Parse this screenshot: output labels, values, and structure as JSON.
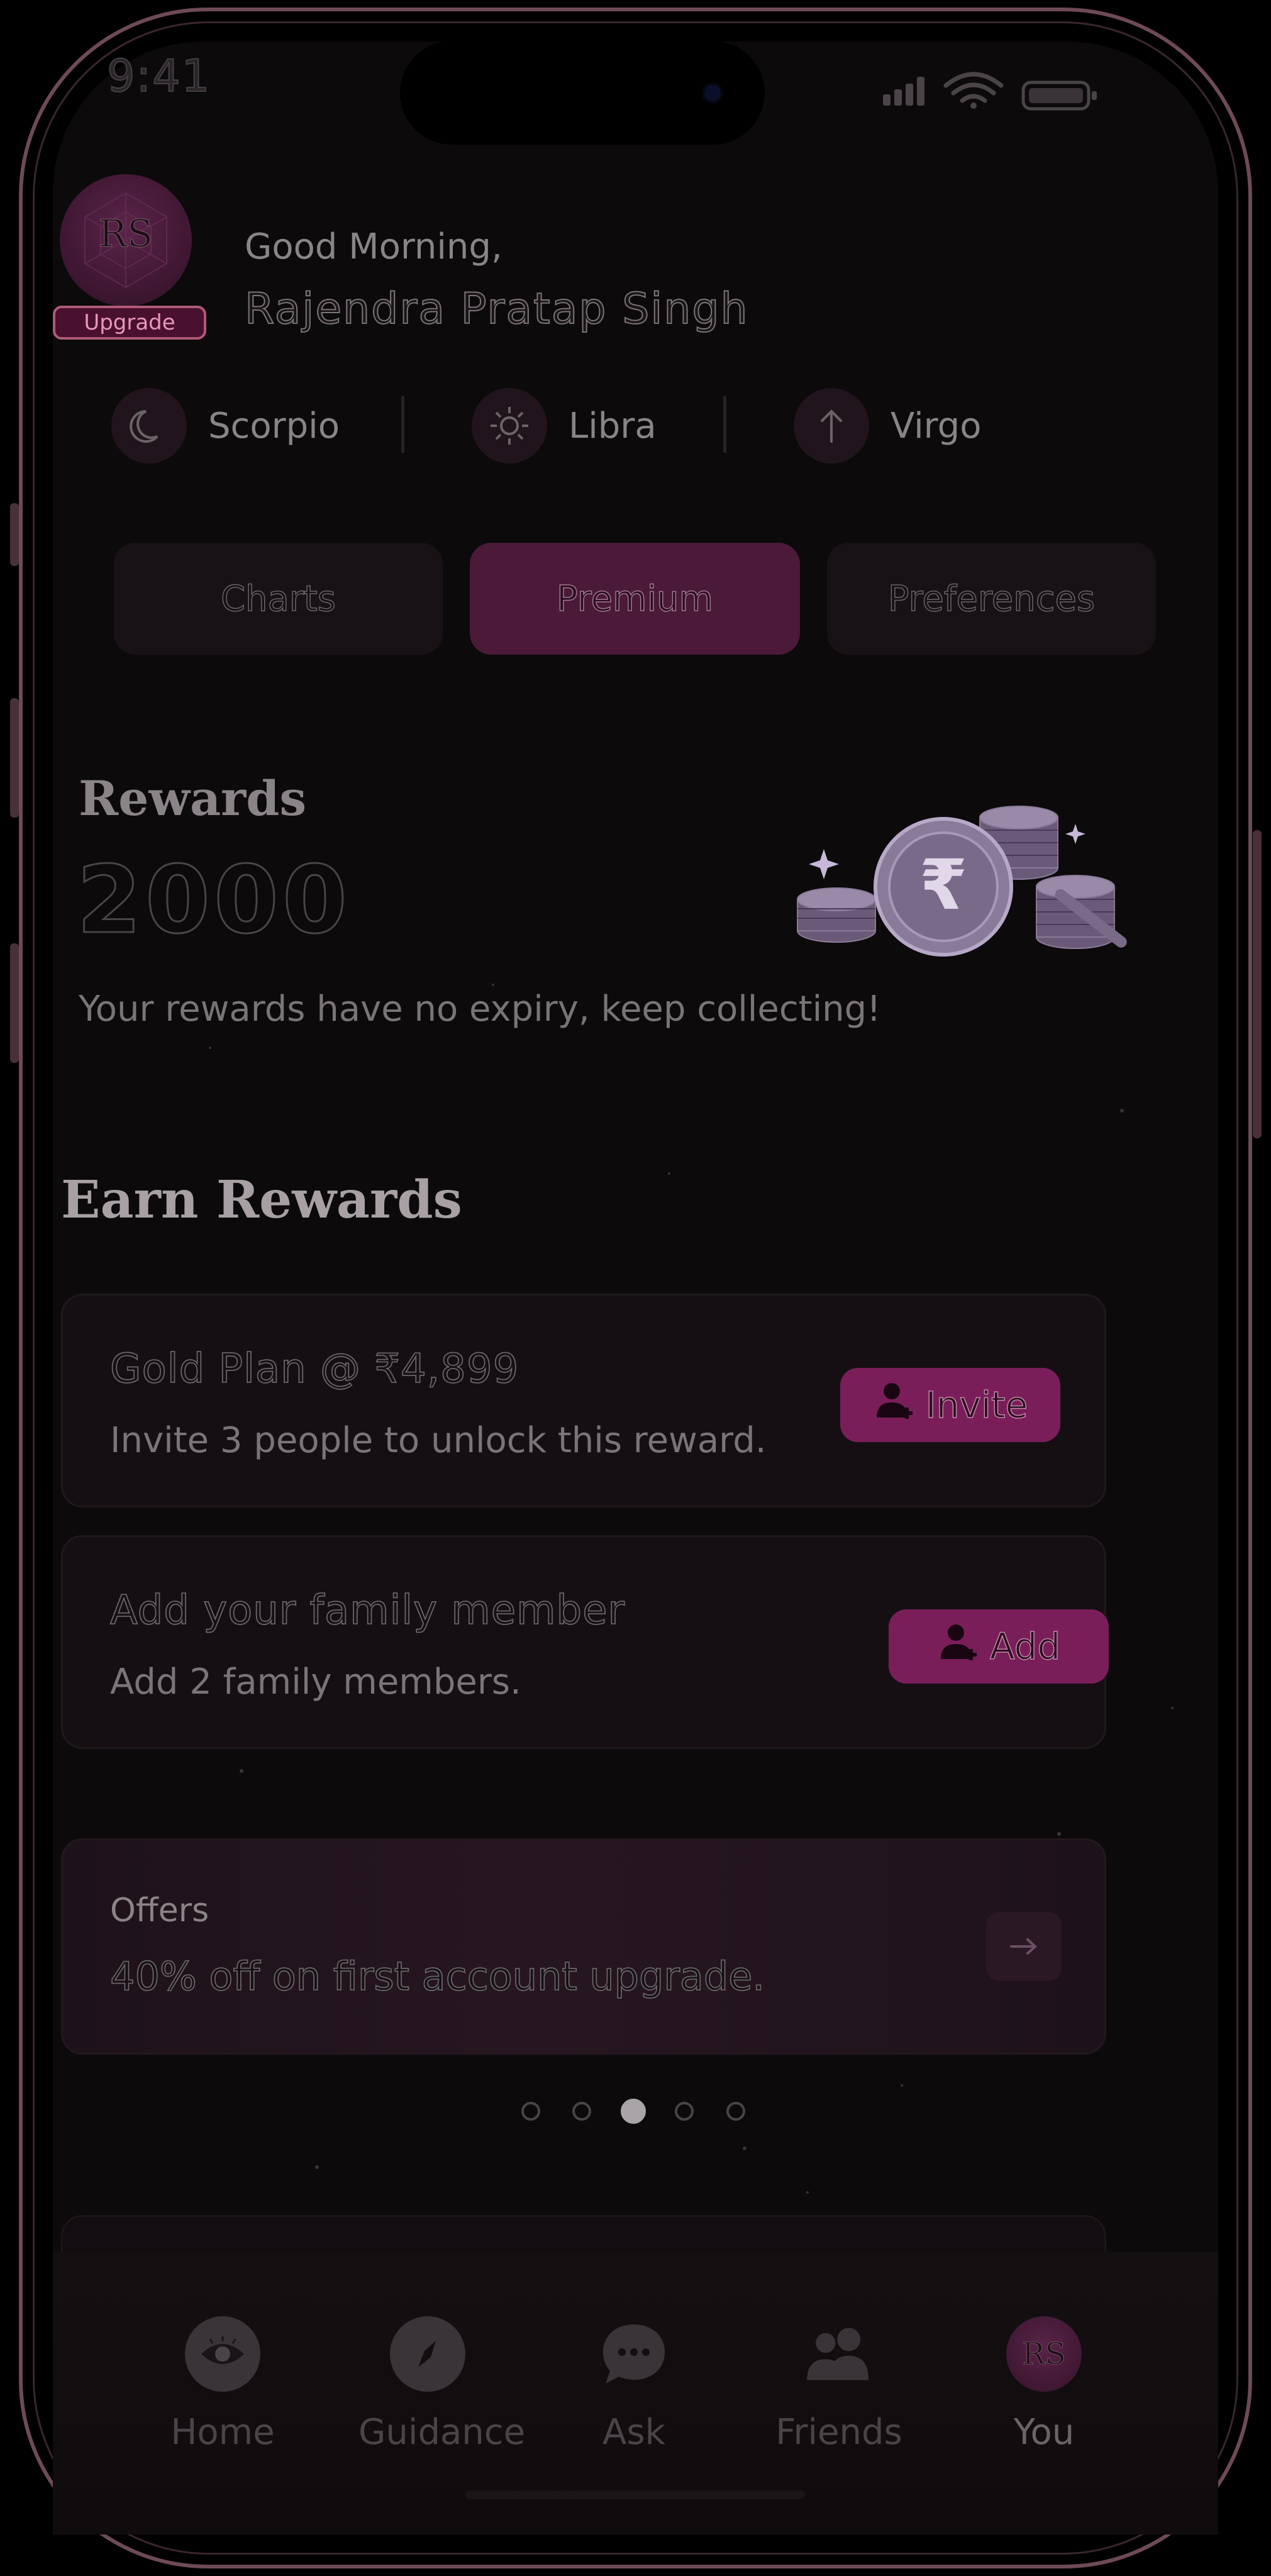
{
  "status_bar": {
    "time": "9:41"
  },
  "profile": {
    "initials": "RS",
    "badge": "Upgrade",
    "greeting": "Good Morning,",
    "name": "Rajendra Pratap Singh"
  },
  "zodiac": [
    {
      "icon": "moon-icon",
      "label": "Scorpio"
    },
    {
      "icon": "sun-icon",
      "label": "Libra"
    },
    {
      "icon": "arrow-up-icon",
      "label": "Virgo"
    }
  ],
  "tabs": [
    {
      "label": "Charts",
      "active": false
    },
    {
      "label": "Premium",
      "active": true
    },
    {
      "label": "Preferences",
      "active": false
    }
  ],
  "rewards": {
    "title": "Rewards",
    "value": "2000",
    "subtitle": "Your rewards have no expiry, keep collecting!"
  },
  "earn": {
    "title": "Earn Rewards",
    "cards": [
      {
        "title": "Gold Plan @ ₹4,899",
        "description": "Invite 3 people to unlock this reward.",
        "button": "Invite",
        "button_icon": "add-user-icon"
      },
      {
        "title": "Add your family member",
        "description": "Add 2 family members.",
        "button": "Add",
        "button_icon": "add-user-icon"
      }
    ]
  },
  "offers": {
    "label": "Offers",
    "text": "40% off on first account upgrade."
  },
  "carousel": {
    "total": 5,
    "active_index": 2
  },
  "nav": [
    {
      "label": "Home",
      "icon": "eye-icon",
      "active": false
    },
    {
      "label": "Guidance",
      "icon": "compass-icon",
      "active": false
    },
    {
      "label": "Ask",
      "icon": "chat-bubble-icon",
      "active": false
    },
    {
      "label": "Friends",
      "icon": "friends-icon",
      "active": false
    },
    {
      "label": "You",
      "icon": "avatar-icon",
      "initials": "RS",
      "active": true
    }
  ],
  "colors": {
    "accent": "#7a1e5a",
    "active_tab": "#4a1a38",
    "background": "#0c0a0b"
  }
}
